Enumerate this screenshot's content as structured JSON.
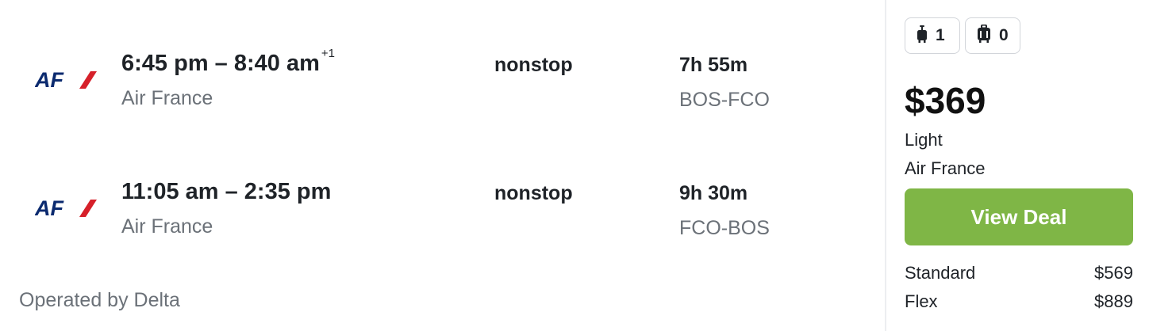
{
  "legs": [
    {
      "times": "6:45 pm – 8:40 am",
      "day_offset": "+1",
      "airline": "Air France",
      "stops": "nonstop",
      "duration": "7h 55m",
      "route": "BOS-FCO",
      "logo_text": "AF"
    },
    {
      "times": "11:05 am – 2:35 pm",
      "day_offset": "",
      "airline": "Air France",
      "stops": "nonstop",
      "duration": "9h 30m",
      "route": "FCO-BOS",
      "logo_text": "AF"
    }
  ],
  "operated_by": "Operated by Delta",
  "panel": {
    "carry_on_count": "1",
    "checked_count": "0",
    "price": "$369",
    "fare_name": "Light",
    "provider": "Air France",
    "cta_label": "View Deal",
    "options": [
      {
        "name": "Standard",
        "price": "$569"
      },
      {
        "name": "Flex",
        "price": "$889"
      }
    ]
  },
  "colors": {
    "cta": "#7fb646",
    "logo_blue": "#0b2a6f",
    "logo_red": "#d6202a",
    "muted_text": "#6b7178"
  },
  "icons": {
    "carry_on": "carry-on-bag-icon",
    "checked": "checked-bag-icon"
  }
}
